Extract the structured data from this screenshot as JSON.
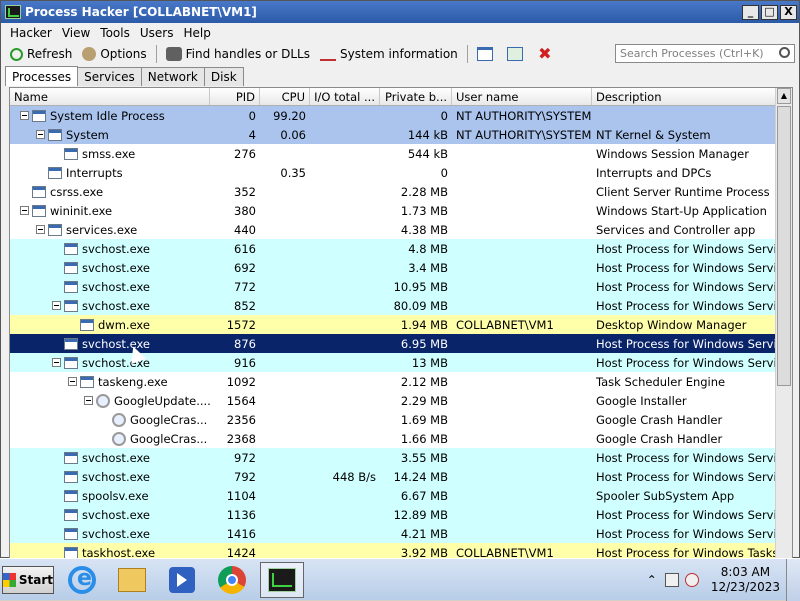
{
  "window": {
    "title": "Process Hacker [COLLABNET\\VM1]",
    "btn_min": "_",
    "btn_max": "□",
    "btn_close": "X"
  },
  "menu": [
    "Hacker",
    "View",
    "Tools",
    "Users",
    "Help"
  ],
  "toolbar": {
    "refresh": "Refresh",
    "options": "Options",
    "find": "Find handles or DLLs",
    "sysinfo": "System information",
    "search_placeholder": "Search Processes (Ctrl+K)"
  },
  "tabs": [
    "Processes",
    "Services",
    "Network",
    "Disk"
  ],
  "columns": {
    "name": "Name",
    "pid": "PID",
    "cpu": "CPU",
    "io": "I/O total ...",
    "priv": "Private b...",
    "user": "User name",
    "desc": "Description"
  },
  "processes": [
    {
      "level": 0,
      "exp": true,
      "name": "System Idle Process",
      "pid": "0",
      "cpu": "99.20",
      "io": "",
      "priv": "0",
      "user": "NT AUTHORITY\\SYSTEM",
      "desc": "",
      "color": "#aac4ee"
    },
    {
      "level": 1,
      "exp": true,
      "name": "System",
      "pid": "4",
      "cpu": "0.06",
      "io": "",
      "priv": "144 kB",
      "user": "NT AUTHORITY\\SYSTEM",
      "desc": "NT Kernel & System",
      "color": "#aac4ee"
    },
    {
      "level": 2,
      "exp": false,
      "name": "smss.exe",
      "pid": "276",
      "cpu": "",
      "io": "",
      "priv": "544 kB",
      "user": "",
      "desc": "Windows Session Manager",
      "color": ""
    },
    {
      "level": 1,
      "exp": false,
      "name": "Interrupts",
      "pid": "",
      "cpu": "0.35",
      "io": "",
      "priv": "0",
      "user": "",
      "desc": "Interrupts and DPCs",
      "color": ""
    },
    {
      "level": 0,
      "exp": false,
      "name": "csrss.exe",
      "pid": "352",
      "cpu": "",
      "io": "",
      "priv": "2.28 MB",
      "user": "",
      "desc": "Client Server Runtime Process",
      "color": ""
    },
    {
      "level": 0,
      "exp": true,
      "name": "wininit.exe",
      "pid": "380",
      "cpu": "",
      "io": "",
      "priv": "1.73 MB",
      "user": "",
      "desc": "Windows Start-Up Application",
      "color": ""
    },
    {
      "level": 1,
      "exp": true,
      "name": "services.exe",
      "pid": "440",
      "cpu": "",
      "io": "",
      "priv": "4.38 MB",
      "user": "",
      "desc": "Services and Controller app",
      "color": ""
    },
    {
      "level": 2,
      "exp": false,
      "name": "svchost.exe",
      "pid": "616",
      "cpu": "",
      "io": "",
      "priv": "4.8 MB",
      "user": "",
      "desc": "Host Process for Windows Services",
      "color": "#d0ffff"
    },
    {
      "level": 2,
      "exp": false,
      "name": "svchost.exe",
      "pid": "692",
      "cpu": "",
      "io": "",
      "priv": "3.4 MB",
      "user": "",
      "desc": "Host Process for Windows Services",
      "color": "#d0ffff"
    },
    {
      "level": 2,
      "exp": false,
      "name": "svchost.exe",
      "pid": "772",
      "cpu": "",
      "io": "",
      "priv": "10.95 MB",
      "user": "",
      "desc": "Host Process for Windows Services",
      "color": "#d0ffff"
    },
    {
      "level": 2,
      "exp": true,
      "name": "svchost.exe",
      "pid": "852",
      "cpu": "",
      "io": "",
      "priv": "80.09 MB",
      "user": "",
      "desc": "Host Process for Windows Services",
      "color": "#d0ffff"
    },
    {
      "level": 3,
      "exp": false,
      "name": "dwm.exe",
      "pid": "1572",
      "cpu": "",
      "io": "",
      "priv": "1.94 MB",
      "user": "COLLABNET\\VM1",
      "desc": "Desktop Window Manager",
      "color": "#ffffaa"
    },
    {
      "level": 2,
      "exp": false,
      "name": "svchost.exe",
      "pid": "876",
      "cpu": "",
      "io": "",
      "priv": "6.95 MB",
      "user": "",
      "desc": "Host Process for Windows Services",
      "color": "",
      "selected": true
    },
    {
      "level": 2,
      "exp": true,
      "name": "svchost.exe",
      "pid": "916",
      "cpu": "",
      "io": "",
      "priv": "13 MB",
      "user": "",
      "desc": "Host Process for Windows Services",
      "color": "#d0ffff"
    },
    {
      "level": 3,
      "exp": true,
      "name": "taskeng.exe",
      "pid": "1092",
      "cpu": "",
      "io": "",
      "priv": "2.12 MB",
      "user": "",
      "desc": "Task Scheduler Engine",
      "color": ""
    },
    {
      "level": 4,
      "exp": true,
      "name": "GoogleUpdate....",
      "pid": "1564",
      "cpu": "",
      "io": "",
      "priv": "2.29 MB",
      "user": "",
      "desc": "Google Installer",
      "color": "",
      "gicon": true
    },
    {
      "level": 5,
      "exp": false,
      "name": "GoogleCras...",
      "pid": "2356",
      "cpu": "",
      "io": "",
      "priv": "1.69 MB",
      "user": "",
      "desc": "Google Crash Handler",
      "color": "",
      "gicon": true
    },
    {
      "level": 5,
      "exp": false,
      "name": "GoogleCras...",
      "pid": "2368",
      "cpu": "",
      "io": "",
      "priv": "1.66 MB",
      "user": "",
      "desc": "Google Crash Handler",
      "color": "",
      "gicon": true
    },
    {
      "level": 2,
      "exp": false,
      "name": "svchost.exe",
      "pid": "972",
      "cpu": "",
      "io": "",
      "priv": "3.55 MB",
      "user": "",
      "desc": "Host Process for Windows Services",
      "color": "#d0ffff"
    },
    {
      "level": 2,
      "exp": false,
      "name": "svchost.exe",
      "pid": "792",
      "cpu": "",
      "io": "448 B/s",
      "priv": "14.24 MB",
      "user": "",
      "desc": "Host Process for Windows Services",
      "color": "#d0ffff"
    },
    {
      "level": 2,
      "exp": false,
      "name": "spoolsv.exe",
      "pid": "1104",
      "cpu": "",
      "io": "",
      "priv": "6.67 MB",
      "user": "",
      "desc": "Spooler SubSystem App",
      "color": "#d0ffff"
    },
    {
      "level": 2,
      "exp": false,
      "name": "svchost.exe",
      "pid": "1136",
      "cpu": "",
      "io": "",
      "priv": "12.89 MB",
      "user": "",
      "desc": "Host Process for Windows Services",
      "color": "#d0ffff"
    },
    {
      "level": 2,
      "exp": false,
      "name": "svchost.exe",
      "pid": "1416",
      "cpu": "",
      "io": "",
      "priv": "4.21 MB",
      "user": "",
      "desc": "Host Process for Windows Services",
      "color": "#d0ffff"
    },
    {
      "level": 2,
      "exp": false,
      "name": "taskhost.exe",
      "pid": "1424",
      "cpu": "",
      "io": "",
      "priv": "3.92 MB",
      "user": "COLLABNET\\VM1",
      "desc": "Host Process for Windows Tasks",
      "color": "#ffffaa"
    }
  ],
  "taskbar": {
    "start_label": "Start",
    "time": "8:03 AM",
    "date": "12/23/2023",
    "tray_chevron": "⌃"
  }
}
